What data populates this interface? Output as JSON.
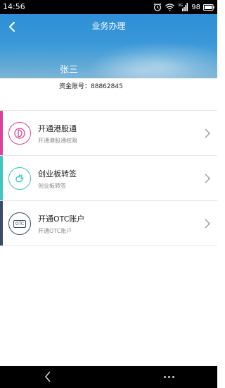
{
  "status_bar": {
    "time": "14:56",
    "battery": "98"
  },
  "header": {
    "title": "业务办理",
    "user_name": "张三"
  },
  "account": {
    "text": "资金账号：88862845"
  },
  "menu": [
    {
      "label": "开通港股通",
      "subtitle": "开通港股通权限",
      "accent": "#e0409a",
      "icon": "hk-connect-icon"
    },
    {
      "label": "创业板转签",
      "subtitle": "创业板转签",
      "accent": "#3cc7c0",
      "icon": "gem-transfer-icon"
    },
    {
      "label": "开通OTC账户",
      "subtitle": "开通OTC账户",
      "accent": "#3a4a6a",
      "icon": "otc-icon",
      "icon_text": "OTC"
    }
  ]
}
